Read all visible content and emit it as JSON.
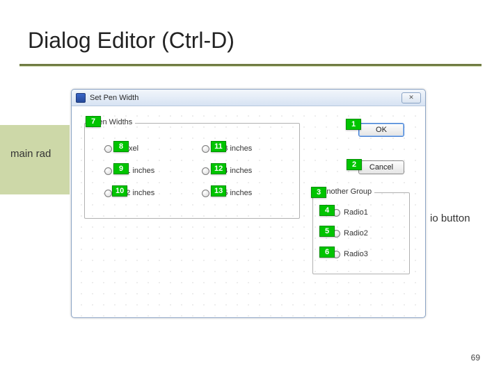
{
  "slide": {
    "title": "Dialog Editor (Ctrl-D)",
    "page_number": "69",
    "left_text": "main rad",
    "right_text": "io button"
  },
  "dialog": {
    "title": "Set Pen Width",
    "close_glyph": "✕",
    "group_pen": {
      "legend": "Pen Widths"
    },
    "group_other": {
      "legend": "Another Group"
    },
    "options": {
      "pixel": "1 Pixel",
      "p01": "0.01 inches",
      "p02": "0.02 inches",
      "p03": "0.03 inches",
      "p04": "0.04 inches",
      "p05": "0.05 inches",
      "r1": "Radio1",
      "r2": "Radio2",
      "r3": "Radio3"
    },
    "buttons": {
      "ok": "OK",
      "cancel": "Cancel"
    }
  },
  "callouts": {
    "c1": "1",
    "c2": "2",
    "c3": "3",
    "c4": "4",
    "c5": "5",
    "c6": "6",
    "c7": "7",
    "c8": "8",
    "c9": "9",
    "c10": "10",
    "c11": "11",
    "c12": "12",
    "c13": "13"
  }
}
